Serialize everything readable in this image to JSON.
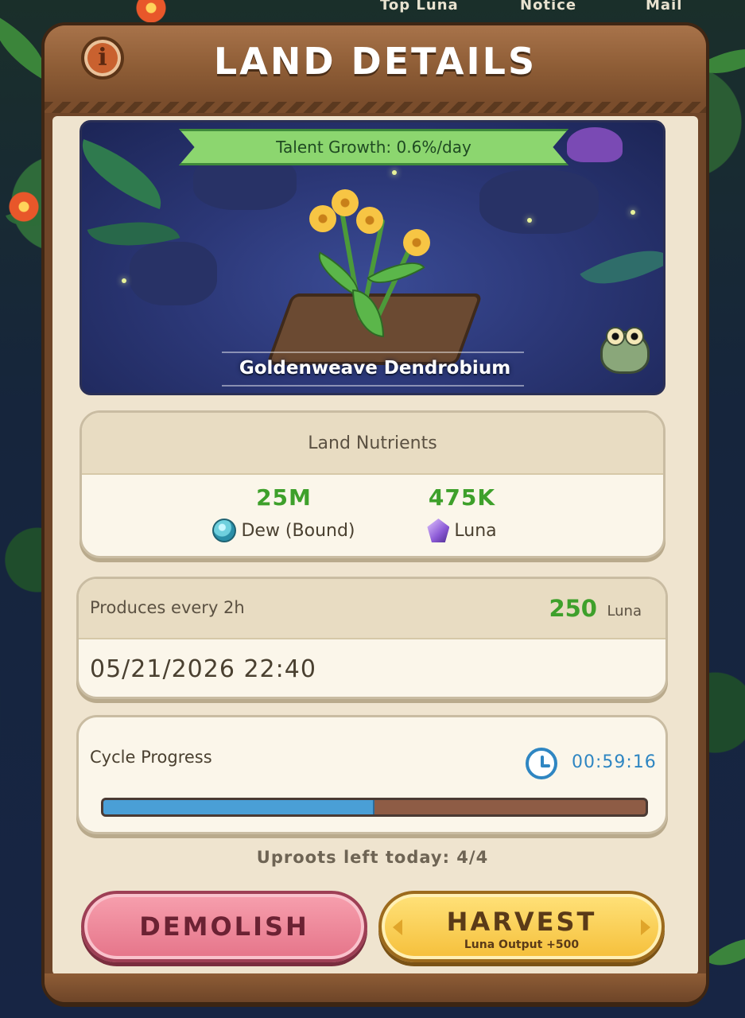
{
  "nav": {
    "top_luna": "Top Luna",
    "notice": "Notice",
    "mail": "Mail"
  },
  "header": {
    "title": "LAND DETAILS",
    "info_icon": "i"
  },
  "scene": {
    "talent_growth": "Talent Growth: 0.6%/day",
    "plant_name": "Goldenweave Dendrobium"
  },
  "nutrients": {
    "heading": "Land Nutrients",
    "dew_value": "25M",
    "dew_label": "Dew (Bound)",
    "luna_value": "475K",
    "luna_label": "Luna"
  },
  "production": {
    "label": "Produces every 2h",
    "amount": "250",
    "unit": "Luna",
    "timestamp": "05/21/2026 22:40"
  },
  "cycle": {
    "label": "Cycle Progress",
    "timer": "00:59:16",
    "progress": 0.5
  },
  "uproots": "Uproots left today: 4/4",
  "buttons": {
    "demolish": "DEMOLISH",
    "harvest": "HARVEST",
    "harvest_sub": "Luna Output +500"
  },
  "colors": {
    "accent_green": "#3ea02b",
    "timer_blue": "#2f86c2",
    "progress_fill": "#4a9fd6"
  }
}
